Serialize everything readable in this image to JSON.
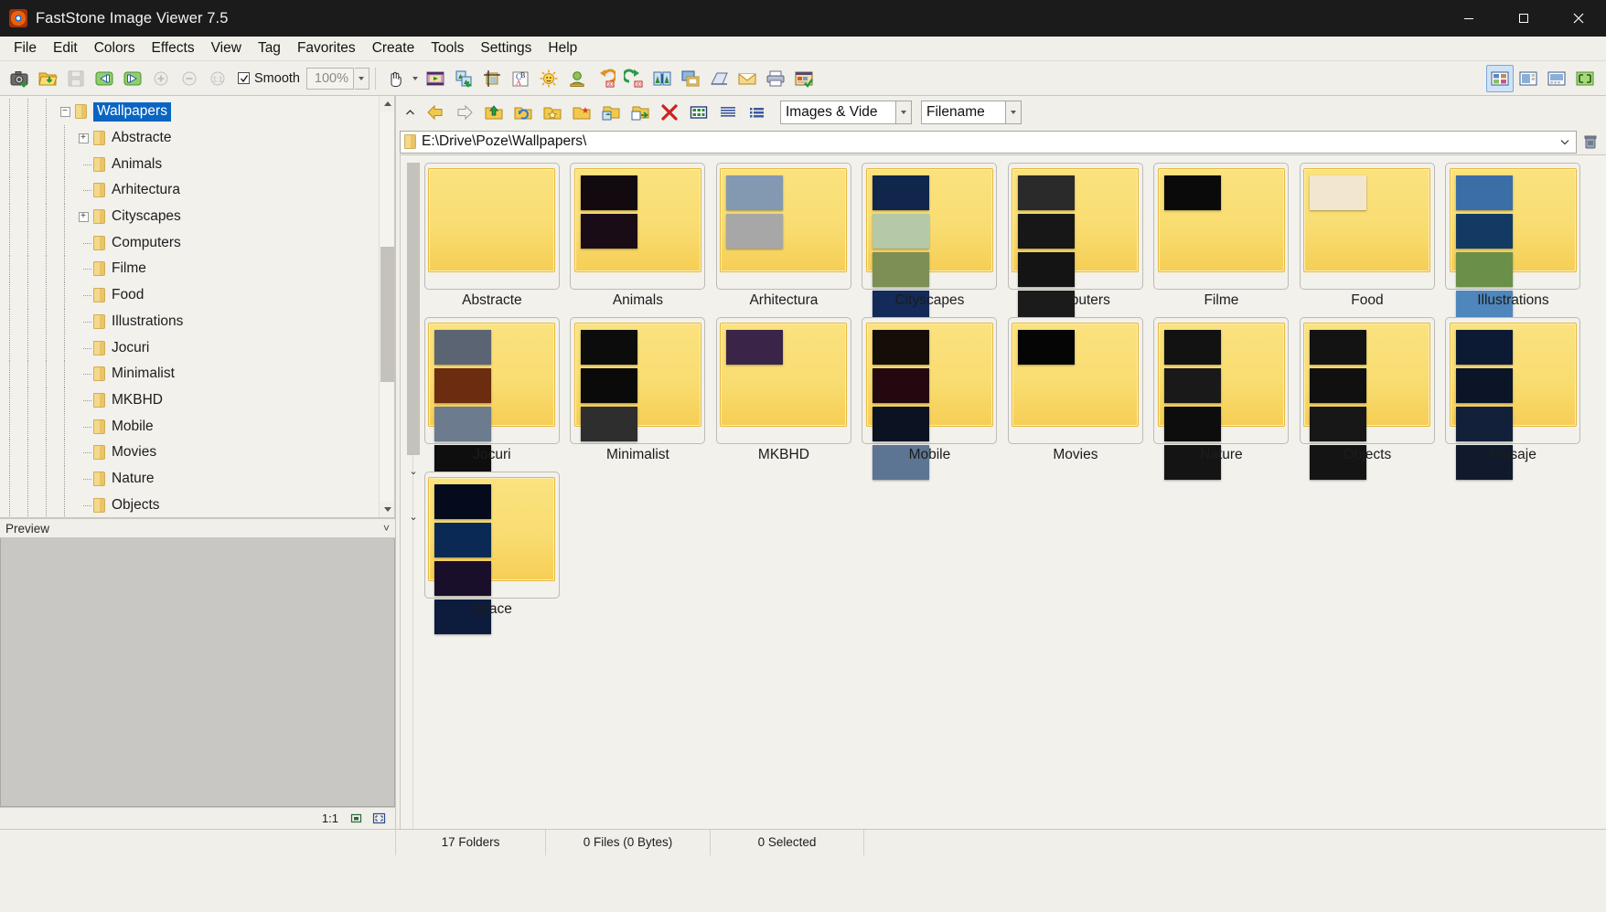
{
  "window": {
    "title": "FastStone Image Viewer 7.5",
    "app_icon": "faststone-logo-icon",
    "minimize": "minimize-icon",
    "maximize": "maximize-icon",
    "close": "close-icon"
  },
  "menubar": {
    "items": [
      "File",
      "Edit",
      "Colors",
      "Effects",
      "View",
      "Tag",
      "Favorites",
      "Create",
      "Tools",
      "Settings",
      "Help"
    ]
  },
  "toolbar": {
    "smooth_label": "Smooth",
    "smooth_checked": true,
    "zoom_value": "100%",
    "buttons": [
      "screen-capture-icon",
      "open-folder-icon",
      "save-icon",
      "previous-image-icon",
      "next-image-icon",
      "zoom-in-icon",
      "zoom-out-icon",
      "actual-size-icon"
    ],
    "buttons_right_group": [
      "pan-hand-icon",
      "slideshow-icon",
      "compare-icon",
      "crop-icon",
      "text-color-icon",
      "adjust-lighting-icon",
      "red-eye-icon",
      "rotate-left-icon",
      "rotate-right-icon",
      "resize-icon",
      "screen-capture-window-icon",
      "scan-icon",
      "email-icon",
      "print-icon",
      "contact-sheet-icon"
    ],
    "far_right_buttons": [
      "thumbnail-view-icon",
      "filmstrip-view-icon",
      "preview-view-icon",
      "fullscreen-icon"
    ]
  },
  "browse_toolbar": {
    "buttons": [
      "back-icon",
      "forward-icon",
      "up-folder-icon",
      "refresh-icon",
      "favorites-folder-icon",
      "new-folder-icon",
      "copy-to-folder-icon",
      "move-to-folder-icon",
      "delete-icon",
      "thumbnail-mode-icon",
      "details-mode-icon",
      "list-mode-icon"
    ],
    "filter_value": "Images & Vide",
    "sort_value": "Filename",
    "collapse_icon": "chevron-up-icon"
  },
  "address_bar": {
    "folder_icon": "folder-icon",
    "path": "E:\\Drive\\Poze\\Wallpapers\\",
    "dropdown_icon": "chevron-down-icon",
    "delete_icon": "trash-icon"
  },
  "tree": {
    "items": [
      {
        "label": "Wallpapers",
        "depth": 0,
        "expander": "minus",
        "selected": true
      },
      {
        "label": "Abstracte",
        "depth": 1,
        "expander": "plus",
        "selected": false
      },
      {
        "label": "Animals",
        "depth": 1,
        "expander": "none",
        "selected": false
      },
      {
        "label": "Arhitectura",
        "depth": 1,
        "expander": "none",
        "selected": false
      },
      {
        "label": "Cityscapes",
        "depth": 1,
        "expander": "plus",
        "selected": false
      },
      {
        "label": "Computers",
        "depth": 1,
        "expander": "none",
        "selected": false
      },
      {
        "label": "Filme",
        "depth": 1,
        "expander": "none",
        "selected": false
      },
      {
        "label": "Food",
        "depth": 1,
        "expander": "none",
        "selected": false
      },
      {
        "label": "Illustrations",
        "depth": 1,
        "expander": "none",
        "selected": false
      },
      {
        "label": "Jocuri",
        "depth": 1,
        "expander": "none",
        "selected": false
      },
      {
        "label": "Minimalist",
        "depth": 1,
        "expander": "none",
        "selected": false
      },
      {
        "label": "MKBHD",
        "depth": 1,
        "expander": "none",
        "selected": false
      },
      {
        "label": "Mobile",
        "depth": 1,
        "expander": "none",
        "selected": false
      },
      {
        "label": "Movies",
        "depth": 1,
        "expander": "none",
        "selected": false
      },
      {
        "label": "Nature",
        "depth": 1,
        "expander": "none",
        "selected": false
      },
      {
        "label": "Objects",
        "depth": 1,
        "expander": "none",
        "selected": false
      }
    ]
  },
  "preview": {
    "header_label": "Preview",
    "collapse_icon": "chevrons-icon",
    "status_text": "1:1",
    "icons": [
      "fit-window-icon",
      "fit-screen-icon"
    ]
  },
  "thumbnails": [
    {
      "label": "Abstracte",
      "minis": []
    },
    {
      "label": "Animals",
      "minis": [
        "#120a0f",
        "#1a0c16"
      ]
    },
    {
      "label": "Arhitectura",
      "minis": [
        "#8399b2",
        "#a7a7a7"
      ]
    },
    {
      "label": "Cityscapes",
      "minis": [
        "#10264a",
        "#b5c9a8",
        "#7d8f54",
        "#142a58"
      ]
    },
    {
      "label": "Computers",
      "minis": [
        "#2a2a2a",
        "#171717",
        "#141414",
        "#1b1b1b"
      ]
    },
    {
      "label": "Filme",
      "minis": [
        "#0a0a0a"
      ]
    },
    {
      "label": "Food",
      "minis": [
        "#f3e6cf"
      ]
    },
    {
      "label": "Illustrations",
      "minis": [
        "#3b6ea6",
        "#123a63",
        "#6a8f49",
        "#4f86bb"
      ]
    },
    {
      "label": "Jocuri",
      "minis": [
        "#5a6472",
        "#6b2c10",
        "#6c7b8d",
        "#0e0e0e"
      ]
    },
    {
      "label": "Minimalist",
      "minis": [
        "#0c0c0c",
        "#0a0a0a",
        "#2e2e2e"
      ]
    },
    {
      "label": "MKBHD",
      "minis": [
        "#3a2448"
      ]
    },
    {
      "label": "Mobile",
      "minis": [
        "#140d08",
        "#240810",
        "#0b1222",
        "#5b7592"
      ]
    },
    {
      "label": "Movies",
      "minis": [
        "#050505"
      ]
    },
    {
      "label": "Nature",
      "minis": [
        "#121212",
        "#191919",
        "#0d0d0d",
        "#141414"
      ]
    },
    {
      "label": "Objects",
      "minis": [
        "#131313",
        "#101010",
        "#171717",
        "#141414"
      ]
    },
    {
      "label": "Peisaje",
      "minis": [
        "#0c1b33",
        "#0b1527",
        "#12203a",
        "#101a2c"
      ]
    },
    {
      "label": "Space",
      "minis": [
        "#050b1c",
        "#0a2a55",
        "#1a0f2a",
        "#0d1c3d"
      ]
    }
  ],
  "statusbar": {
    "folders": "17 Folders",
    "files": "0 Files (0 Bytes)",
    "selected": "0 Selected"
  }
}
